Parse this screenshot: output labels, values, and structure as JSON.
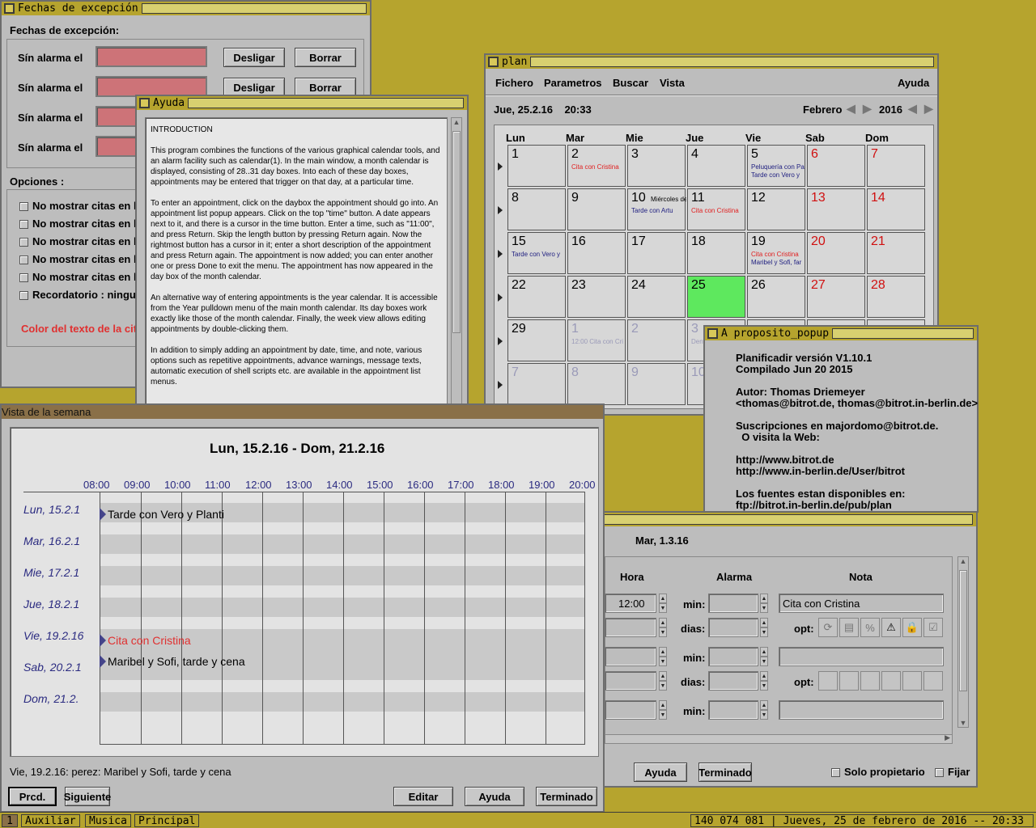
{
  "fechas": {
    "title": "Fechas de excepción",
    "heading": "Fechas de excepción:",
    "row_label": "Sín alarma el",
    "unlink": "Desligar",
    "delete": "Borrar",
    "options_heading": "Opciones :",
    "option": "No mostrar citas en la",
    "reminder": "Recordatorio : ninguna",
    "color_label": "Color del texto de la cita"
  },
  "ayuda": {
    "title": "Ayuda",
    "p1": "INTRODUCTION",
    "p2": "This program combines the functions of the various graphical calendar tools, and an alarm facility such as calendar(1). In the main window, a month calendar is displayed, consisting of 28..31 day boxes. Into each of these day boxes, appointments may be entered that trigger on that day, at a particular time.",
    "p3": "To enter an appointment, click on the daybox the appointment should go into. An appointment list popup appears. Click on the top \"time\" button. A date appears next to it, and there is a cursor in the time button. Enter a time, such as \"11:00\", and press Return. Skip the length button by pressing Return again. Now the rightmost button has a cursor in it; enter a short description of the appointment and press Return again. The appointment is now added; you can enter another one or press Done to exit the menu. The appointment has now appeared in the day box of the month calendar.",
    "p4": "An alternative way of entering appointments is the year calendar. It is accessible from the Year pulldown menu of the main month calendar. Its day boxes work exactly like those of the month calendar. Finally, the week view allows editing appointments by double-clicking them.",
    "p5": "In addition to simply adding an appointment by date, time, and note, various options such as repetitive appointments, advance warnings, message texts, automatic execution of shell scripts etc. are available in the appointment list menus."
  },
  "plan": {
    "title": "plan",
    "menu": [
      "Fichero",
      "Parametros",
      "Buscar",
      "Vista"
    ],
    "help": "Ayuda",
    "now": "Jue, 25.2.16    20:33",
    "month": "Febrero",
    "year": "2016",
    "weekdays": [
      "Lun",
      "Mar",
      "Mie",
      "Jue",
      "Vie",
      "Sab",
      "Dom"
    ],
    "cells": [
      {
        "n": "1",
        "a": "",
        "c": "#000",
        "ac": "#000"
      },
      {
        "n": "2",
        "a": "Cita con Cristina",
        "c": "#000",
        "ac": "#e02020"
      },
      {
        "n": "3",
        "a": "",
        "c": "#000",
        "ac": "#000"
      },
      {
        "n": "4",
        "a": "",
        "c": "#000",
        "ac": "#000"
      },
      {
        "n": "5",
        "a": "Peluquería con Pa",
        "a2": "Tarde con Vero y",
        "c": "#000",
        "ac": "#202080"
      },
      {
        "n": "6",
        "a": "",
        "c": "#d01010",
        "ac": "#000"
      },
      {
        "n": "7",
        "a": "",
        "c": "#d01010",
        "ac": "#000"
      },
      {
        "n": "8",
        "a": "",
        "c": "#000",
        "ac": "#000"
      },
      {
        "n": "9",
        "a": "",
        "c": "#000",
        "ac": "#000"
      },
      {
        "n": "10",
        "a": "Tarde con Artu",
        "extra": "Miércoles de",
        "c": "#000",
        "ac": "#202080"
      },
      {
        "n": "11",
        "a": "Cita con Cristina",
        "c": "#000",
        "ac": "#e02020"
      },
      {
        "n": "12",
        "a": "",
        "c": "#000",
        "ac": "#000"
      },
      {
        "n": "13",
        "a": "",
        "c": "#d01010",
        "ac": "#000"
      },
      {
        "n": "14",
        "a": "",
        "c": "#d01010",
        "ac": "#000"
      },
      {
        "n": "15",
        "a": "Tarde con Vero y",
        "c": "#000",
        "ac": "#202080"
      },
      {
        "n": "16",
        "a": "",
        "c": "#000",
        "ac": "#000"
      },
      {
        "n": "17",
        "a": "",
        "c": "#000",
        "ac": "#000"
      },
      {
        "n": "18",
        "a": "",
        "c": "#000",
        "ac": "#000"
      },
      {
        "n": "19",
        "a": "Cita con Cristina",
        "a2": "Maribel y Sofi, far",
        "c": "#000",
        "ac": "#e02020"
      },
      {
        "n": "20",
        "a": "",
        "c": "#d01010",
        "ac": "#000"
      },
      {
        "n": "21",
        "a": "",
        "c": "#d01010",
        "ac": "#000"
      },
      {
        "n": "22",
        "a": "",
        "c": "#000",
        "ac": "#000"
      },
      {
        "n": "23",
        "a": "",
        "c": "#000",
        "ac": "#000"
      },
      {
        "n": "24",
        "a": "",
        "c": "#000",
        "ac": "#000"
      },
      {
        "n": "25",
        "a": "",
        "c": "#000",
        "ac": "#000",
        "today": true
      },
      {
        "n": "26",
        "a": "",
        "c": "#000",
        "ac": "#000"
      },
      {
        "n": "27",
        "a": "",
        "c": "#d01010",
        "ac": "#000"
      },
      {
        "n": "28",
        "a": "",
        "c": "#d01010",
        "ac": "#000"
      },
      {
        "n": "29",
        "a": "",
        "c": "#000",
        "ac": "#000"
      },
      {
        "n": "1",
        "a": "12:00 Cita con Cri",
        "c": "#9a9ab8",
        "ac": "#9a9ab8"
      },
      {
        "n": "2",
        "a": "",
        "c": "#9a9ab8",
        "ac": "#000"
      },
      {
        "n": "3",
        "a": "Dent",
        "c": "#9a9ab8",
        "ac": "#9a9ab8"
      },
      {
        "n": "",
        "a": "",
        "c": "#000",
        "ac": "#000"
      },
      {
        "n": "",
        "a": "",
        "c": "#000",
        "ac": "#000"
      },
      {
        "n": "",
        "a": "",
        "c": "#000",
        "ac": "#000"
      },
      {
        "n": "7",
        "a": "",
        "c": "#9a9ab8",
        "ac": "#000"
      },
      {
        "n": "8",
        "a": "",
        "c": "#9a9ab8",
        "ac": "#000"
      },
      {
        "n": "9",
        "a": "",
        "c": "#9a9ab8",
        "ac": "#000"
      },
      {
        "n": "10",
        "a": "",
        "c": "#9a9ab8",
        "ac": "#000"
      },
      {
        "n": "",
        "a": "",
        "c": "#000",
        "ac": "#000"
      },
      {
        "n": "",
        "a": "",
        "c": "#000",
        "ac": "#000"
      },
      {
        "n": "",
        "a": "",
        "c": "#000",
        "ac": "#000"
      }
    ]
  },
  "about": {
    "title": "A proposito_popup",
    "l1": "Planificadir versión V1.10.1",
    "l2": "Compilado Jun 20 2015",
    "l3": "Autor: Thomas Driemeyer",
    "l4": "<thomas@bitrot.de, thomas@bitrot.in-berlin.de>",
    "l5": "Suscripciones en majordomo@bitrot.de.",
    "l6": "  O visita la Web:",
    "l7": "http://www.bitrot.de",
    "l8": "http://www.in-berlin.de/User/bitrot",
    "l9": "Los fuentes estan disponibles en:",
    "l10": "ftp://bitrot.in-berlin.de/pub/plan"
  },
  "list": {
    "date": "Mar, 1.3.16",
    "hora": "Hora",
    "alarma": "Alarma",
    "nota": "Nota",
    "time": "12:00",
    "min": "min:",
    "dias": "dias:",
    "opt": "opt:",
    "note": "Cita con Cristina",
    "help": "Ayuda",
    "done": "Terminado",
    "owner": "Solo propietario",
    "fix": "Fijar"
  },
  "semana": {
    "title": "Vista de la semana",
    "range": "Lun, 15.2.16 - Dom, 21.2.16",
    "hours": [
      "08:00",
      "09:00",
      "10:00",
      "11:00",
      "12:00",
      "13:00",
      "14:00",
      "15:00",
      "16:00",
      "17:00",
      "18:00",
      "19:00",
      "20:00"
    ],
    "days": [
      "Lun, 15.2.1",
      "Mar, 16.2.1",
      "Mie, 17.2.1",
      "Jue, 18.2.1",
      "Vie, 19.2.16",
      "Sab, 20.2.1",
      "Dom, 21.2."
    ],
    "ev1": "Tarde con Vero y Planti",
    "ev2": "Cita con Cristina",
    "ev3": "Maribel y Sofi, tarde y cena",
    "status": "Vie, 19.2.16: perez: Maribel y Sofi, tarde y cena",
    "prev": "Prcd.",
    "next": "Siguiente",
    "edit": "Editar",
    "help": "Ayuda",
    "done": "Terminado"
  },
  "taskbar": {
    "desk": "1",
    "items": [
      "Auxiliar",
      "Musica",
      "Principal"
    ],
    "status": "140 074 081 | Jueves, 25 de febrero de 2016 -- 20:33"
  }
}
